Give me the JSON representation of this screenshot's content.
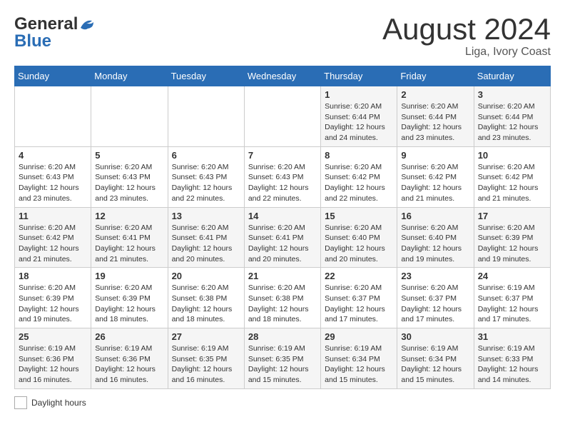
{
  "header": {
    "logo_line1": "General",
    "logo_line2": "Blue",
    "month": "August 2024",
    "location": "Liga, Ivory Coast"
  },
  "weekdays": [
    "Sunday",
    "Monday",
    "Tuesday",
    "Wednesday",
    "Thursday",
    "Friday",
    "Saturday"
  ],
  "weeks": [
    [
      {
        "day": "",
        "info": ""
      },
      {
        "day": "",
        "info": ""
      },
      {
        "day": "",
        "info": ""
      },
      {
        "day": "",
        "info": ""
      },
      {
        "day": "1",
        "info": "Sunrise: 6:20 AM\nSunset: 6:44 PM\nDaylight: 12 hours\nand 24 minutes."
      },
      {
        "day": "2",
        "info": "Sunrise: 6:20 AM\nSunset: 6:44 PM\nDaylight: 12 hours\nand 23 minutes."
      },
      {
        "day": "3",
        "info": "Sunrise: 6:20 AM\nSunset: 6:44 PM\nDaylight: 12 hours\nand 23 minutes."
      }
    ],
    [
      {
        "day": "4",
        "info": "Sunrise: 6:20 AM\nSunset: 6:43 PM\nDaylight: 12 hours\nand 23 minutes."
      },
      {
        "day": "5",
        "info": "Sunrise: 6:20 AM\nSunset: 6:43 PM\nDaylight: 12 hours\nand 23 minutes."
      },
      {
        "day": "6",
        "info": "Sunrise: 6:20 AM\nSunset: 6:43 PM\nDaylight: 12 hours\nand 22 minutes."
      },
      {
        "day": "7",
        "info": "Sunrise: 6:20 AM\nSunset: 6:43 PM\nDaylight: 12 hours\nand 22 minutes."
      },
      {
        "day": "8",
        "info": "Sunrise: 6:20 AM\nSunset: 6:42 PM\nDaylight: 12 hours\nand 22 minutes."
      },
      {
        "day": "9",
        "info": "Sunrise: 6:20 AM\nSunset: 6:42 PM\nDaylight: 12 hours\nand 21 minutes."
      },
      {
        "day": "10",
        "info": "Sunrise: 6:20 AM\nSunset: 6:42 PM\nDaylight: 12 hours\nand 21 minutes."
      }
    ],
    [
      {
        "day": "11",
        "info": "Sunrise: 6:20 AM\nSunset: 6:42 PM\nDaylight: 12 hours\nand 21 minutes."
      },
      {
        "day": "12",
        "info": "Sunrise: 6:20 AM\nSunset: 6:41 PM\nDaylight: 12 hours\nand 21 minutes."
      },
      {
        "day": "13",
        "info": "Sunrise: 6:20 AM\nSunset: 6:41 PM\nDaylight: 12 hours\nand 20 minutes."
      },
      {
        "day": "14",
        "info": "Sunrise: 6:20 AM\nSunset: 6:41 PM\nDaylight: 12 hours\nand 20 minutes."
      },
      {
        "day": "15",
        "info": "Sunrise: 6:20 AM\nSunset: 6:40 PM\nDaylight: 12 hours\nand 20 minutes."
      },
      {
        "day": "16",
        "info": "Sunrise: 6:20 AM\nSunset: 6:40 PM\nDaylight: 12 hours\nand 19 minutes."
      },
      {
        "day": "17",
        "info": "Sunrise: 6:20 AM\nSunset: 6:39 PM\nDaylight: 12 hours\nand 19 minutes."
      }
    ],
    [
      {
        "day": "18",
        "info": "Sunrise: 6:20 AM\nSunset: 6:39 PM\nDaylight: 12 hours\nand 19 minutes."
      },
      {
        "day": "19",
        "info": "Sunrise: 6:20 AM\nSunset: 6:39 PM\nDaylight: 12 hours\nand 18 minutes."
      },
      {
        "day": "20",
        "info": "Sunrise: 6:20 AM\nSunset: 6:38 PM\nDaylight: 12 hours\nand 18 minutes."
      },
      {
        "day": "21",
        "info": "Sunrise: 6:20 AM\nSunset: 6:38 PM\nDaylight: 12 hours\nand 18 minutes."
      },
      {
        "day": "22",
        "info": "Sunrise: 6:20 AM\nSunset: 6:37 PM\nDaylight: 12 hours\nand 17 minutes."
      },
      {
        "day": "23",
        "info": "Sunrise: 6:20 AM\nSunset: 6:37 PM\nDaylight: 12 hours\nand 17 minutes."
      },
      {
        "day": "24",
        "info": "Sunrise: 6:19 AM\nSunset: 6:37 PM\nDaylight: 12 hours\nand 17 minutes."
      }
    ],
    [
      {
        "day": "25",
        "info": "Sunrise: 6:19 AM\nSunset: 6:36 PM\nDaylight: 12 hours\nand 16 minutes."
      },
      {
        "day": "26",
        "info": "Sunrise: 6:19 AM\nSunset: 6:36 PM\nDaylight: 12 hours\nand 16 minutes."
      },
      {
        "day": "27",
        "info": "Sunrise: 6:19 AM\nSunset: 6:35 PM\nDaylight: 12 hours\nand 16 minutes."
      },
      {
        "day": "28",
        "info": "Sunrise: 6:19 AM\nSunset: 6:35 PM\nDaylight: 12 hours\nand 15 minutes."
      },
      {
        "day": "29",
        "info": "Sunrise: 6:19 AM\nSunset: 6:34 PM\nDaylight: 12 hours\nand 15 minutes."
      },
      {
        "day": "30",
        "info": "Sunrise: 6:19 AM\nSunset: 6:34 PM\nDaylight: 12 hours\nand 15 minutes."
      },
      {
        "day": "31",
        "info": "Sunrise: 6:19 AM\nSunset: 6:33 PM\nDaylight: 12 hours\nand 14 minutes."
      }
    ]
  ],
  "legend": {
    "daylight_label": "Daylight hours"
  }
}
